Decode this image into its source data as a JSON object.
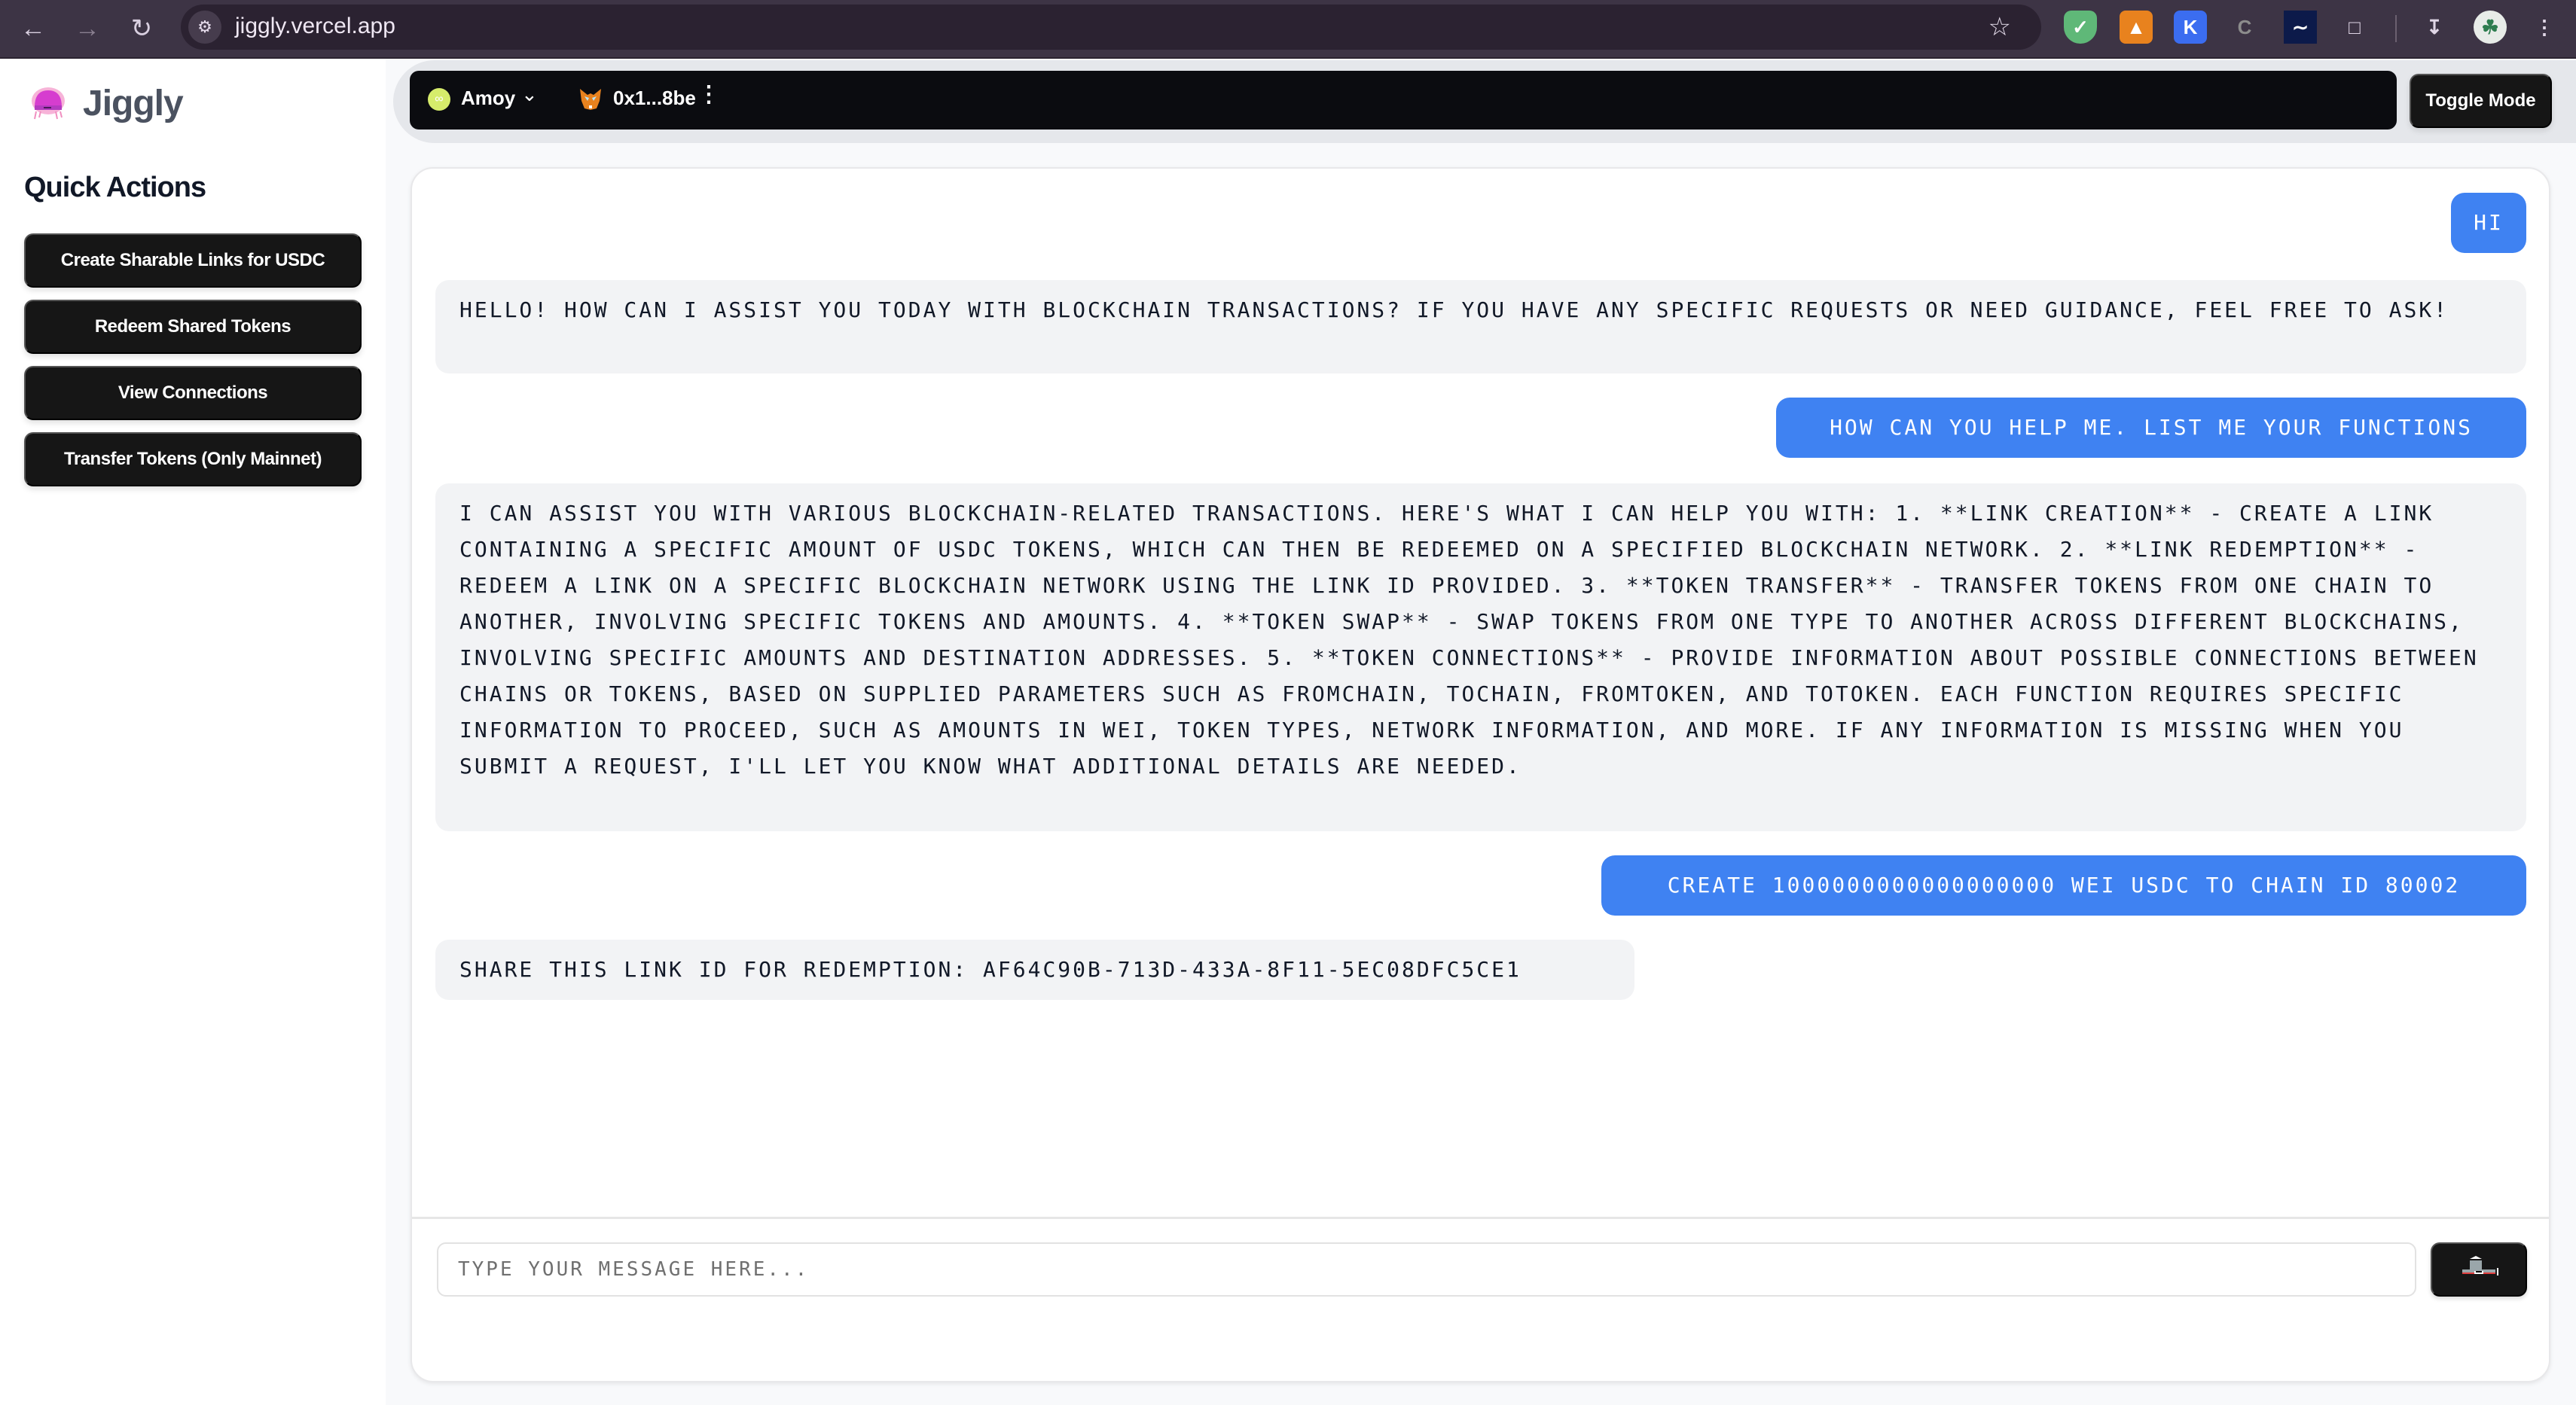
{
  "browser": {
    "url": "jiggly.vercel.app",
    "extensions": [
      "adguard-icon",
      "metamask-icon",
      "k-extension-icon",
      "c-extension-icon",
      "chart-extension-icon",
      "extensions-puzzle-icon"
    ]
  },
  "sidebar": {
    "brand": "Jiggly",
    "section_title": "Quick Actions",
    "actions": [
      {
        "label": "Create Sharable Links for USDC"
      },
      {
        "label": "Redeem Shared Tokens"
      },
      {
        "label": "View Connections"
      },
      {
        "label": "Transfer Tokens (Only Mainnet)"
      }
    ]
  },
  "header": {
    "chain": "Amoy",
    "account": "0x1...8be",
    "toggle_label": "Toggle Mode"
  },
  "chat": {
    "messages": [
      {
        "role": "user",
        "text": "HI"
      },
      {
        "role": "assistant",
        "text": "Hello! How can I assist you today with blockchain transactions? If you have any specific requests or need guidance, feel free to ask!"
      },
      {
        "role": "user",
        "text": "How can you help me. List me your functions"
      },
      {
        "role": "assistant",
        "text": "I can assist you with various blockchain-related transactions. Here's what I can help you with: 1. **Link Creation** - Create a link containing a specific amount of USDC tokens, which can then be redeemed on a specified blockchain network. 2. **Link Redemption** - Redeem a link on a specific blockchain network using the link ID provided. 3. **Token Transfer** - Transfer tokens from one chain to another, involving specific tokens and amounts. 4. **Token Swap** - Swap tokens from one type to another across different blockchains, involving specific amounts and destination addresses. 5. **Token Connections** - Provide information about possible connections between chains or tokens, based on supplied parameters such as fromChain, toChain, fromToken, and toToken. Each function requires specific information to proceed, such as amounts in wei, token types, network information, and more. If any information is missing when you submit a request, I'll let you know what additional details are needed."
      },
      {
        "role": "user",
        "text": "Create 1000000000000000000 wei USDC to chain ID 80002"
      },
      {
        "role": "assistant",
        "text": "Share this link ID for redemption: af64c90b-713d-433a-8f11-5ec08dfc5ce1"
      }
    ],
    "input_placeholder": "Type your message here...",
    "input_value": ""
  },
  "colors": {
    "user_bubble": "#3f82f2",
    "bot_bubble": "#f2f3f5",
    "button_dark": "#161616",
    "chain_dot": "#d6ec6b"
  }
}
